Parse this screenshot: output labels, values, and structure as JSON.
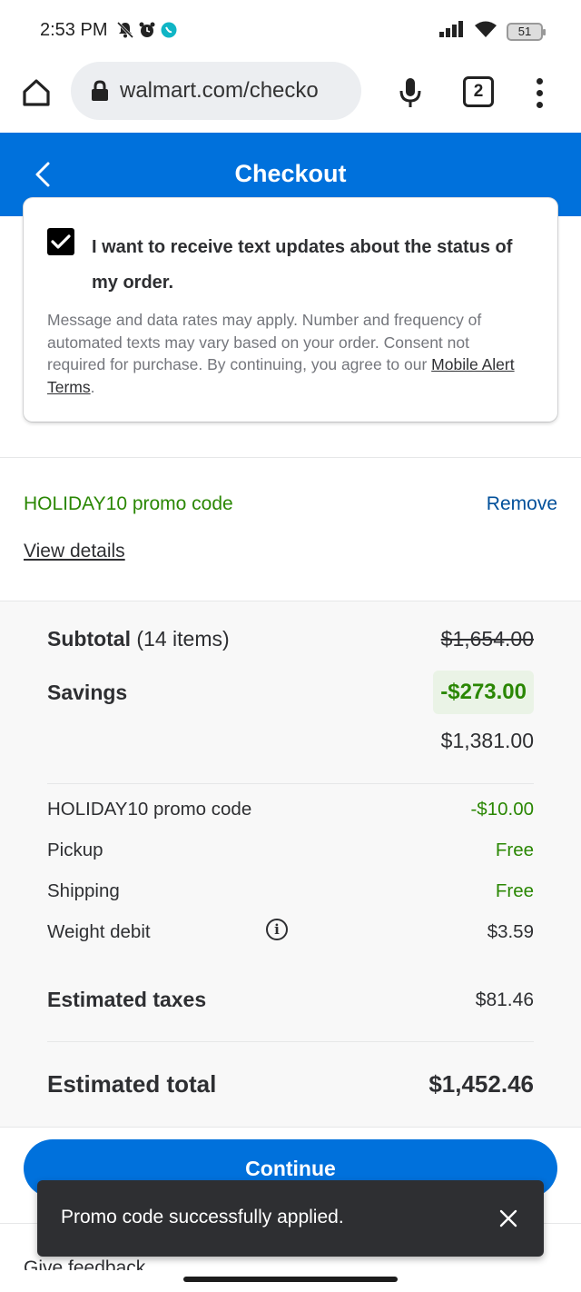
{
  "status_bar": {
    "time": "2:53 PM",
    "battery": "51",
    "icons": [
      "notifications-off-icon",
      "alarm-icon",
      "messenger-icon",
      "signal-icon",
      "wifi-icon",
      "battery-icon"
    ]
  },
  "browser": {
    "url": "walmart.com/checko",
    "tab_count": "2",
    "icons": [
      "home-icon",
      "lock-icon",
      "mic-icon",
      "tabs-icon",
      "menu-icon"
    ]
  },
  "header": {
    "title": "Checkout",
    "back_icon": "chevron-left-icon"
  },
  "consent": {
    "checked": true,
    "label": "I want to receive text updates about the status of my order.",
    "note": "Message and data rates may apply. Number and frequency of automated texts may vary based on your order. Consent not required for purchase. By continuing, you agree to our ",
    "link_text": "Mobile Alert Terms",
    "note_end": "."
  },
  "promo": {
    "code_label": "HOLIDAY10 promo code",
    "remove_label": "Remove",
    "view_details": "View details"
  },
  "summary": {
    "subtotal_label": "Subtotal",
    "subtotal_count": "(14 items)",
    "subtotal_original": "$1,654.00",
    "savings_label": "Savings",
    "savings_value": "-$273.00",
    "net_subtotal": "$1,381.00",
    "lines": [
      {
        "label": "HOLIDAY10 promo code",
        "value": "-$10.00"
      },
      {
        "label": "Pickup",
        "value": "Free"
      },
      {
        "label": "Shipping",
        "value": "Free"
      },
      {
        "label": "Weight debit",
        "value": "$3.59"
      }
    ],
    "taxes_label": "Estimated taxes",
    "taxes_value": "$81.46",
    "total_label": "Estimated total",
    "total_value": "$1,452.46"
  },
  "continue_label": "Continue",
  "toast": {
    "message": "Promo code successfully applied."
  },
  "footer_peek": "Give feedback",
  "colors": {
    "brand_blue": "#0071dc",
    "savings_green": "#2a8703",
    "link_blue": "#004f9a",
    "toast_bg": "#2e2f32"
  }
}
